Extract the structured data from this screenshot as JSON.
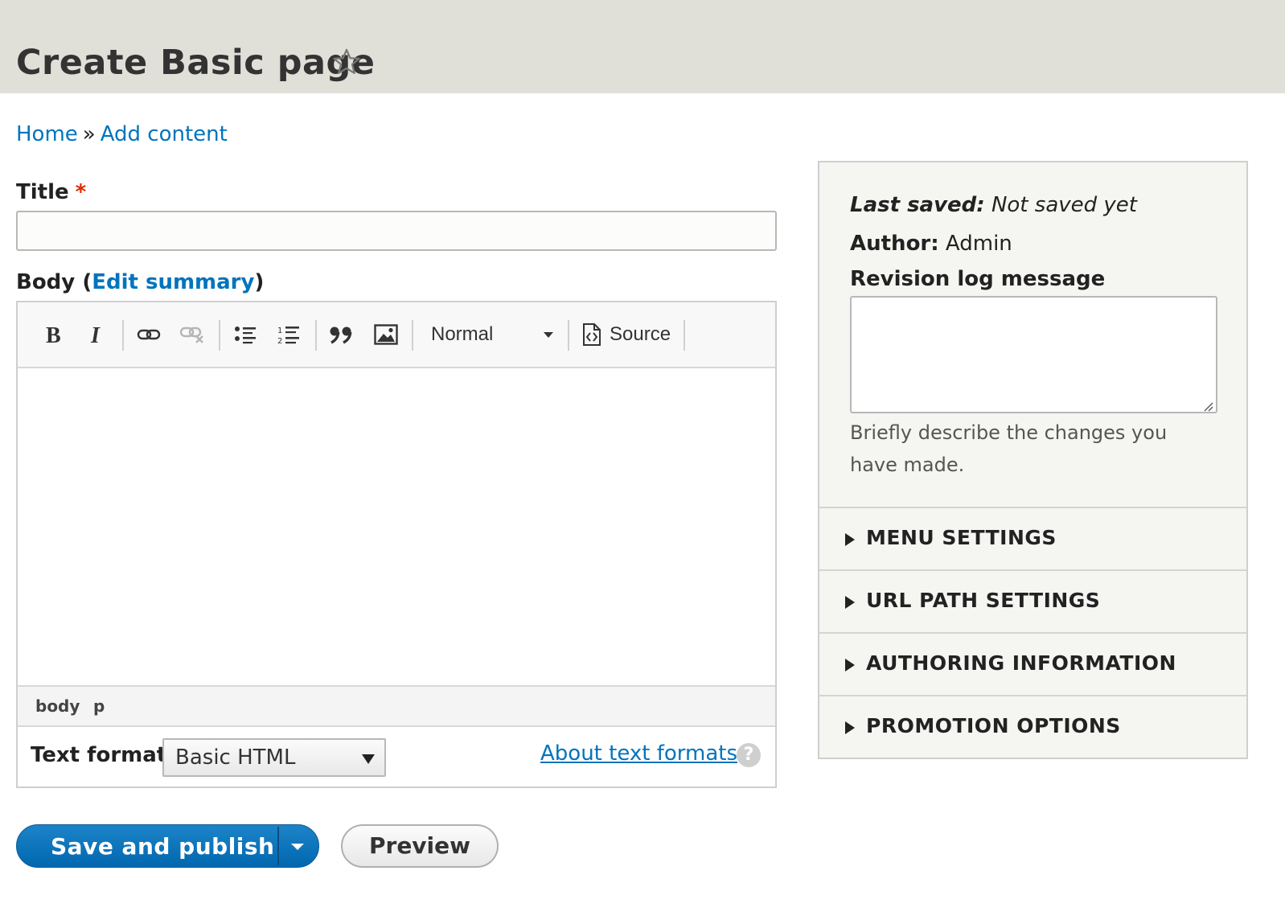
{
  "header": {
    "title": "Create Basic page",
    "favorite_icon": "star-outline-icon"
  },
  "breadcrumb": {
    "home": "Home",
    "separator": "»",
    "current": "Add content"
  },
  "form": {
    "title_label": "Title",
    "required_mark": "*",
    "title_value": "",
    "body_label": "Body",
    "body_open": "(",
    "body_link": "Edit summary",
    "body_close": ")"
  },
  "toolbar": {
    "buttons": [
      "bold-icon",
      "italic-icon",
      "link-icon",
      "unlink-icon",
      "bulleted-list-icon",
      "numbered-list-icon",
      "blockquote-icon",
      "image-icon"
    ],
    "format_value": "Normal",
    "source_label": "Source"
  },
  "pathbar": {
    "items": [
      "body",
      "p"
    ]
  },
  "text_format": {
    "label": "Text format",
    "selected": "Basic HTML",
    "help_link": "About text formats",
    "help_icon_glyph": "?"
  },
  "actions": {
    "primary": "Save and publish",
    "secondary": "Preview"
  },
  "sidebar": {
    "last_saved_label": "Last saved:",
    "last_saved_value": "Not saved yet",
    "author_label": "Author:",
    "author_value": "Admin",
    "revision_label": "Revision log message",
    "revision_value": "",
    "revision_help": "Briefly describe the changes you have made.",
    "sections": [
      "MENU SETTINGS",
      "URL PATH SETTINGS",
      "AUTHORING INFORMATION",
      "PROMOTION OPTIONS"
    ]
  },
  "colors": {
    "link": "#0074bd",
    "primary_button": "#0074bd",
    "required": "#e32700",
    "header_bg": "#e0e0d8"
  }
}
